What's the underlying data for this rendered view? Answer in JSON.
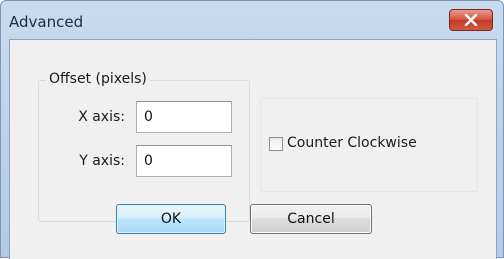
{
  "window": {
    "title": "Advanced",
    "close_icon": "close-x-icon"
  },
  "offset_group": {
    "label": "Offset (pixels)",
    "x_label": "X axis:",
    "x_value": "0",
    "y_label": "Y axis:",
    "y_value": "0"
  },
  "options": {
    "counter_clockwise_label": "Counter Clockwise",
    "counter_clockwise_checked": false
  },
  "buttons": {
    "ok_label": "OK",
    "cancel_label": "Cancel"
  },
  "colors": {
    "title_bar": "#c8dbef",
    "client_bg": "#f0f0f0",
    "close_button": "#c7412c",
    "ok_border": "#3c7fb1"
  }
}
